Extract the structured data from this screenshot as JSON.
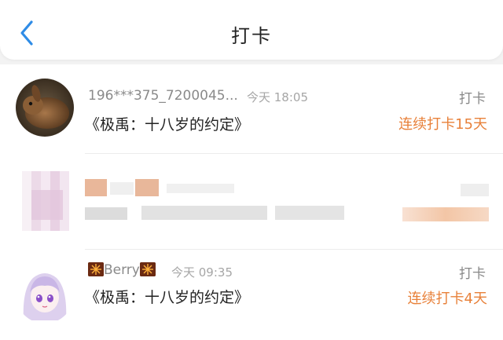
{
  "header": {
    "title": "打卡"
  },
  "items": [
    {
      "name": "196***375_7200045...",
      "time": "今天 18:05",
      "topic": "《极禹：十八岁的约定》",
      "tag": "打卡",
      "streak": "连续打卡15天"
    },
    {
      "name": "",
      "time": "",
      "topic": "",
      "tag": "",
      "streak": ""
    },
    {
      "name": "Berry",
      "time": "今天 09:35",
      "topic": "《极禹：十八岁的约定》",
      "tag": "打卡",
      "streak": "连续打卡4天"
    }
  ],
  "colors": {
    "accent": "#e8813a",
    "back": "#2f8ce6"
  },
  "icons": [
    "chevron-left-icon",
    "firework-icon"
  ]
}
